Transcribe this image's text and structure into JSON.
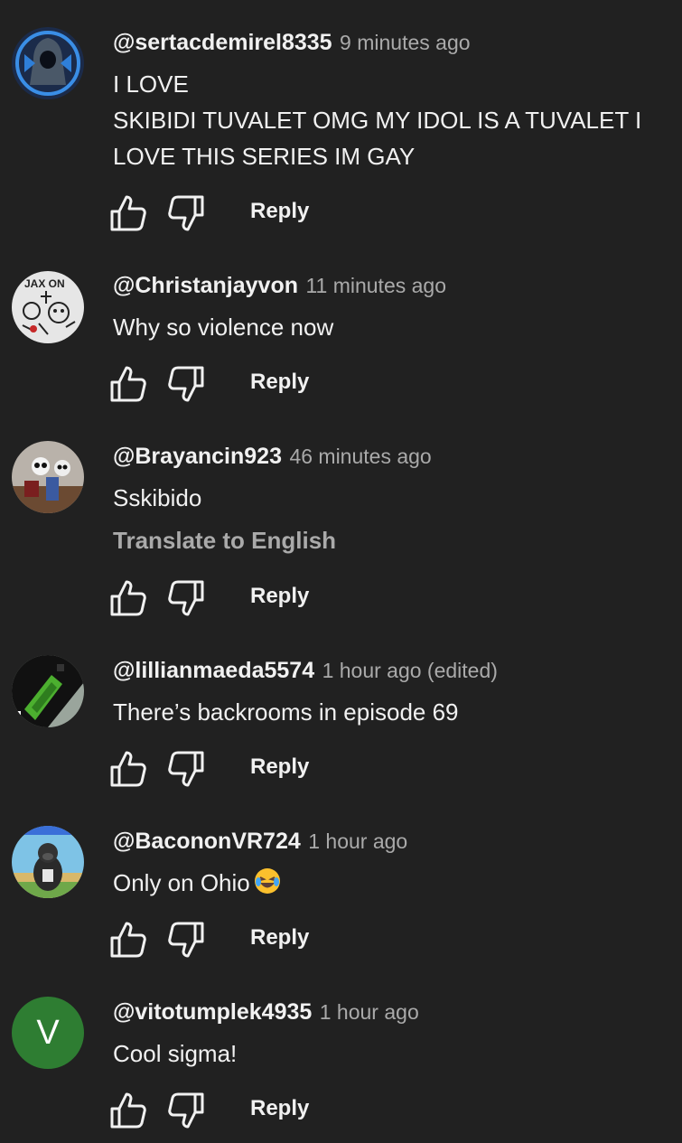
{
  "comments": [
    {
      "author": "@sertacdemirel8335",
      "time": "9 minutes ago",
      "lines": [
        "I LOVE",
        "SKIBIDI TUVALET OMG MY IDOL IS A TUVALET I",
        "LOVE THIS SERIES IM GAY"
      ],
      "reply_label": "Reply",
      "avatar_icon": "hooded-figure-avatar"
    },
    {
      "author": "@Christanjayvon",
      "time": "11 minutes ago",
      "lines": [
        "Why so violence now"
      ],
      "reply_label": "Reply",
      "avatar_icon": "doodle-avatar",
      "avatar_text": "JAX ON"
    },
    {
      "author": "@Brayancin923",
      "time": "46 minutes ago",
      "lines": [
        "Sskibido"
      ],
      "translate_label": "Translate to English",
      "reply_label": "Reply",
      "avatar_icon": "toys-photo-avatar"
    },
    {
      "author": "@lillianmaeda5574",
      "time": "1 hour ago (edited)",
      "lines": [
        "There’s backrooms in episode 69"
      ],
      "reply_label": "Reply",
      "avatar_icon": "pixel-art-avatar"
    },
    {
      "author": "@BacononVR724",
      "time": "1 hour ago",
      "lines": [
        "Only on Ohio"
      ],
      "emoji": "laughing-emoji",
      "reply_label": "Reply",
      "avatar_icon": "gorilla-avatar"
    },
    {
      "author": "@vitotumplek4935",
      "time": "1 hour ago",
      "lines": [
        "Cool sigma!"
      ],
      "reply_label": "Reply",
      "avatar_letter": "V",
      "avatar_color": "#2e7d32"
    }
  ],
  "colors": {
    "background": "#212121",
    "primary_text": "#f1f1f1",
    "secondary_text": "#aaaaaa"
  }
}
